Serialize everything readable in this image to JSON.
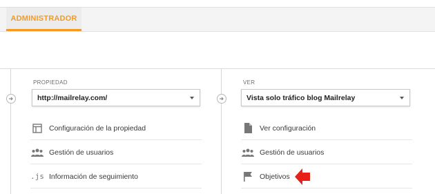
{
  "topbar": {
    "tab_label": "ADMINISTRADOR"
  },
  "property": {
    "label": "PROPIEDAD",
    "selected": "http://mailrelay.com/",
    "items": [
      {
        "label": "Configuración de la propiedad",
        "icon": "property-settings-icon"
      },
      {
        "label": "Gestión de usuarios",
        "icon": "users-icon"
      },
      {
        "label": "Información de seguimiento",
        "icon": "js-icon"
      }
    ]
  },
  "view": {
    "label": "VER",
    "selected": "Vista solo tráfico blog Mailrelay",
    "items": [
      {
        "label": "Ver configuración",
        "icon": "document-icon"
      },
      {
        "label": "Gestión de usuarios",
        "icon": "users-icon"
      },
      {
        "label": "Objetivos",
        "icon": "flag-icon"
      }
    ]
  },
  "colors": {
    "accent": "#f49a22",
    "arrow": "#e8201a"
  }
}
